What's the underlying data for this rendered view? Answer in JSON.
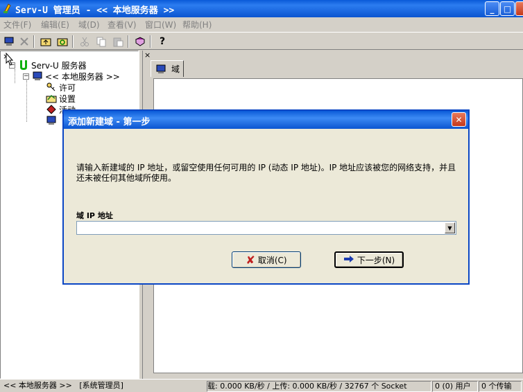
{
  "window": {
    "title": "Serv-U 管理员 - << 本地服务器 >>",
    "min": "_",
    "max": "□",
    "close": "✕"
  },
  "menu": [
    {
      "label": "文件(F)"
    },
    {
      "label": "编辑(E)"
    },
    {
      "label": "域(D)"
    },
    {
      "label": "查看(V)"
    },
    {
      "label": "窗口(W)"
    },
    {
      "label": "帮助(H)"
    }
  ],
  "pane_close": "×",
  "tree": {
    "root": "Serv-U 服务器",
    "server": "<< 本地服务器 >>",
    "children": [
      "许可",
      "设置",
      "活动"
    ]
  },
  "tab": {
    "label": "域"
  },
  "dialog": {
    "title": "添加新建域 - 第一步",
    "message": "请输入新建域的 IP 地址，或留空使用任何可用的 IP (动态 IP 地址)。IP 地址应该被您的网络支持，并且还未被任何其他域所使用。",
    "field_label": "域 IP 地址",
    "field_value": "",
    "cancel_label": "取消(C)",
    "next_label": "下一步(N)"
  },
  "status": {
    "server": "<< 本地服务器 >>",
    "role": "[系统管理员]",
    "transfer": "载: 0.000 KB/秒 / 上传: 0.000 KB/秒 / 32767 个 Socket",
    "users": "0 (0) 用户",
    "transfers": "0 个传输"
  },
  "colors": {
    "title_blue": "#0a5ad8",
    "close_red": "#c4381c",
    "dialog_bg": "#ece9d8"
  }
}
